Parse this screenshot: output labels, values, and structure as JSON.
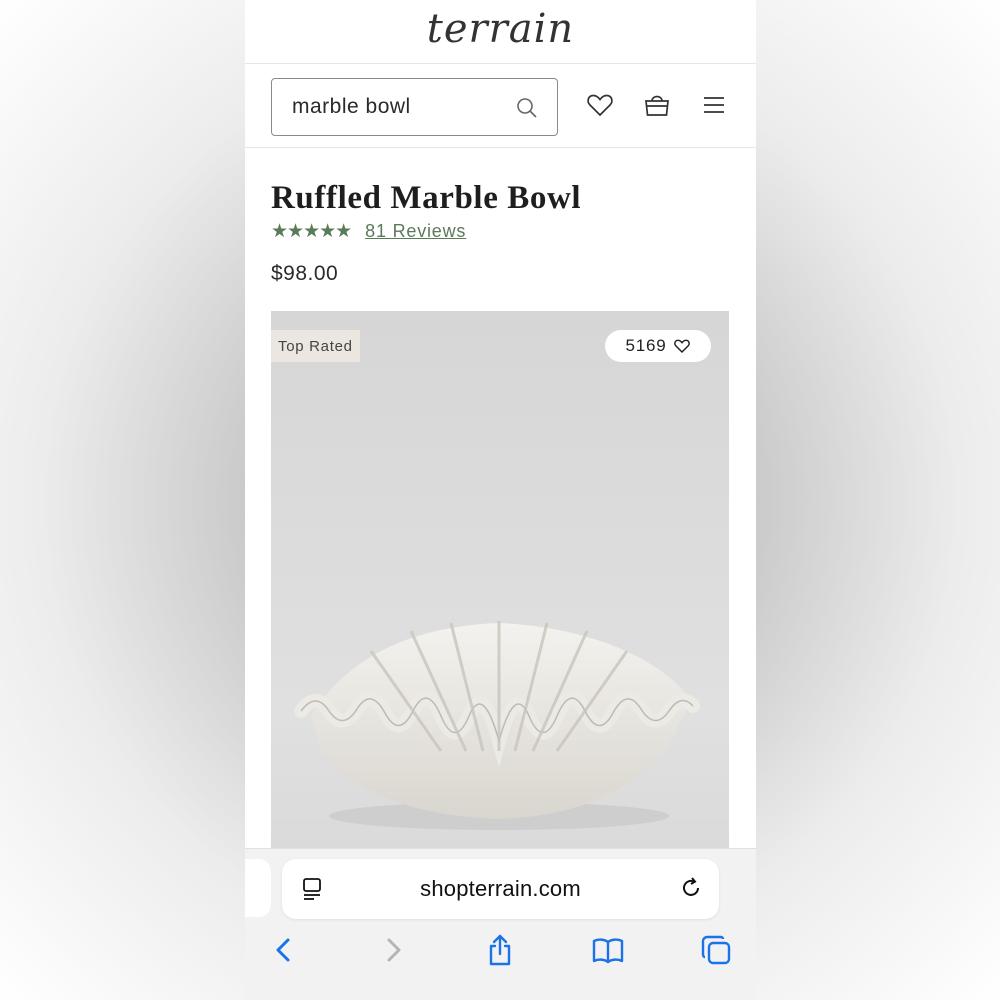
{
  "header": {
    "logo_text": "terrain"
  },
  "search": {
    "value": "marble bowl",
    "icon": "search-icon"
  },
  "nav_icons": [
    "heart-icon",
    "shopping-bag-icon",
    "menu-icon"
  ],
  "product": {
    "title": "Ruffled Marble Bowl",
    "rating_stars": "★★★★★",
    "rating": 5,
    "reviews_label": "81 Reviews",
    "price": "$98.00",
    "badge": "Top Rated",
    "favorites_count": "5169"
  },
  "browser": {
    "url": "shopterrain.com",
    "toolbar_icons": [
      "back-icon",
      "forward-icon",
      "share-icon",
      "bookmarks-icon",
      "tabs-icon"
    ]
  },
  "colors": {
    "accent_green": "#5b7a58",
    "safari_blue": "#1a73e8",
    "badge_bg": "#ebe7e0"
  }
}
